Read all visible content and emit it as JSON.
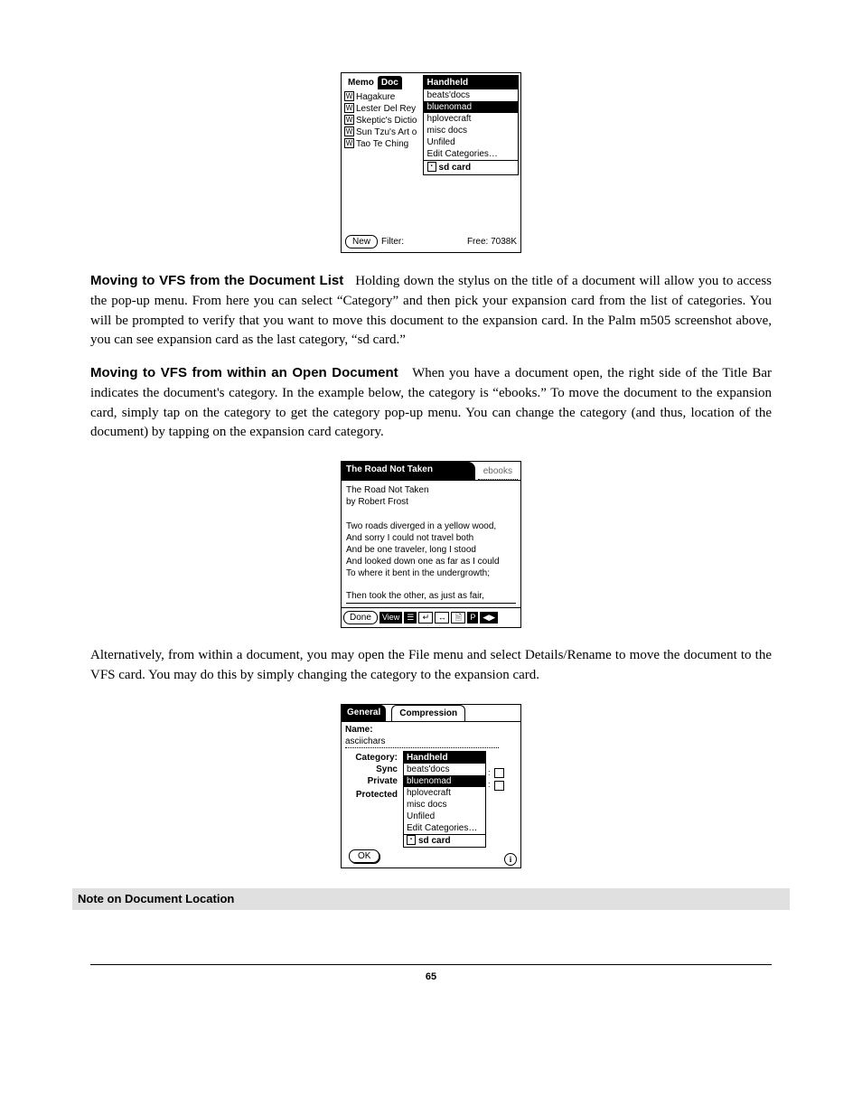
{
  "ss1": {
    "tabs": {
      "memo": "Memo",
      "doc": "Doc"
    },
    "list": [
      "Hagakure",
      "Lester Del Rey",
      "Skeptic's Dictio",
      "Sun Tzu's Art o",
      "Tao Te Ching"
    ],
    "dropdown": {
      "header": "Handheld",
      "items": [
        "beats'docs",
        "bluenomad",
        "hplovecraft",
        "misc docs",
        "Unfiled",
        "Edit Categories…"
      ],
      "highlight_index": 1,
      "footer": "sd card"
    },
    "new_btn": "New",
    "filter_label": "Filter:",
    "free": "Free: 7038K"
  },
  "para1": {
    "heading": "Moving to VFS from the Document List",
    "body": "Holding down the stylus on the title of a document will allow you to access the pop-up menu. From here you can select “Category” and then pick your expansion card from the list of categories. You will be prompted to verify that you want to move this document to the expansion card. In the Palm m505 screenshot above, you can see expansion card as the last category, “sd card.”"
  },
  "para2": {
    "heading": "Moving to VFS from within an Open Document",
    "body": "When you have a document open, the right side of the Title Bar indicates the document's category.  In the example below, the category is “ebooks.”  To move the document to the expansion card, simply tap on the category to get the category pop-up menu.  You can change the category (and thus, location of the document) by tapping on the expansion card category."
  },
  "ss2": {
    "title": "The Road Not Taken",
    "category": "ebooks",
    "line_title": "The Road Not Taken",
    "line_author": "by Robert Frost",
    "stanza": [
      "Two roads diverged in a yellow wood,",
      "And sorry I could not travel both",
      "And be one traveler, long I stood",
      "And looked down one as far as I could",
      "To where it bent in the undergrowth;"
    ],
    "last_visible": "Then took the other, as just as fair,",
    "done": "Done",
    "view": "View"
  },
  "para3": "Alternatively, from within a document, you may open the File menu and select Details/Rename to move the document to the VFS card.  You may do this by simply changing the category to the expansion card.",
  "ss3": {
    "tabs": {
      "general": "General",
      "compression": "Compression"
    },
    "labels": {
      "name": "Name:",
      "category": "Category:",
      "sync": "Sync",
      "private": "Private",
      "protected": "Protected"
    },
    "name_value": "asciichars",
    "dropdown": {
      "header": "Handheld",
      "items": [
        "beats'docs",
        "bluenomad",
        "hplovecraft",
        "misc docs",
        "Unfiled",
        "Edit Categories…"
      ],
      "highlight_index": 1,
      "footer": "sd card"
    },
    "ok": "OK",
    "info": "i"
  },
  "section_note": "Note on Document Location",
  "page_number": "65"
}
